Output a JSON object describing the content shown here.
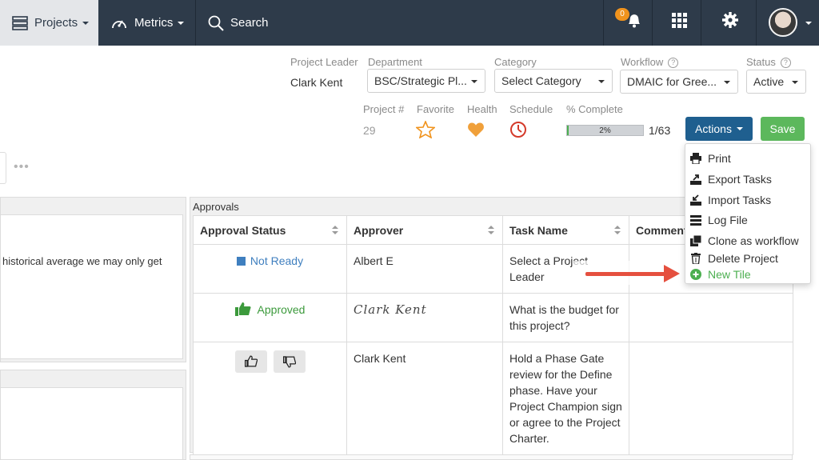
{
  "nav": {
    "projects_label": "Projects",
    "metrics_label": "Metrics",
    "search_label": "Search",
    "notification_count": "0",
    "colors": {
      "bg": "#2e3b4a",
      "active_bg": "#e4e6e9",
      "badge": "#f0931d"
    }
  },
  "header": {
    "project_leader": {
      "label": "Project Leader",
      "value": "Clark Kent"
    },
    "department": {
      "label": "Department",
      "value": "BSC/Strategic Pl..."
    },
    "category": {
      "label": "Category",
      "value": "Select Category"
    },
    "workflow": {
      "label": "Workflow",
      "value": "DMAIC for Gree...",
      "help": "?"
    },
    "status": {
      "label": "Status",
      "value": "Active",
      "help": "?"
    },
    "project_number": {
      "label": "Project #",
      "value": "29"
    },
    "favorite": {
      "label": "Favorite"
    },
    "health": {
      "label": "Health"
    },
    "schedule": {
      "label": "Schedule"
    },
    "percent_complete": {
      "label": "% Complete",
      "value": 2,
      "text": "2%",
      "tasks": "1/63"
    },
    "actions_label": "Actions",
    "save_label": "Save"
  },
  "actions_menu": [
    {
      "label": "Print",
      "icon": "print-icon"
    },
    {
      "label": "Export Tasks",
      "icon": "export-icon"
    },
    {
      "label": "Import Tasks",
      "icon": "import-icon"
    },
    {
      "label": "Log File",
      "icon": "log-file-icon"
    },
    {
      "label": "Clone as workflow",
      "icon": "clone-icon"
    },
    {
      "label": "Delete Project",
      "icon": "trash-icon"
    },
    {
      "label": "New Tile",
      "icon": "plus-circle-icon"
    }
  ],
  "left_panel": {
    "dots": "•••",
    "text": "historical average we may only get"
  },
  "approvals": {
    "title": "Approvals",
    "columns": [
      "Approval Status",
      "Approver",
      "Task Name",
      "Comment"
    ],
    "rows": [
      {
        "status": "Not Ready",
        "approver": "Albert E",
        "task": "Select a Project Leader"
      },
      {
        "status": "Approved",
        "approver_signature": "Clark Kent",
        "task": "What is the budget for this project?"
      },
      {
        "status": "",
        "approver": "Clark Kent",
        "task": "Hold a Phase Gate review for the Define phase. Have your Project Champion sign or agree to the Project Charter."
      }
    ]
  }
}
